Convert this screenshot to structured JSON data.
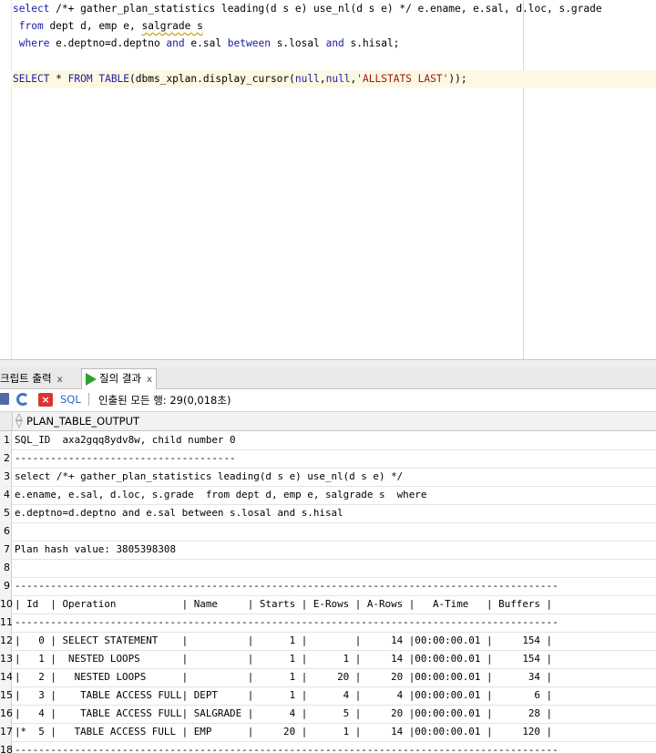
{
  "editor": {
    "lines": [
      {
        "tokens": [
          {
            "t": "select",
            "c": "kw"
          },
          {
            "t": " /*+ gather_plan_statistics leading(d s e) use_nl(d s e) */ e.ename, e.sal, d.loc, s.grade",
            "c": "cm"
          }
        ]
      },
      {
        "tokens": [
          {
            "t": " ",
            "c": ""
          },
          {
            "t": "from",
            "c": "kw"
          },
          {
            "t": " dept d, emp e, ",
            "c": ""
          },
          {
            "t": "salgrade s",
            "c": "sq"
          }
        ]
      },
      {
        "tokens": [
          {
            "t": " ",
            "c": ""
          },
          {
            "t": "where",
            "c": "kw"
          },
          {
            "t": " e.deptno=d.deptno ",
            "c": ""
          },
          {
            "t": "and",
            "c": "kw"
          },
          {
            "t": " e.sal ",
            "c": ""
          },
          {
            "t": "between",
            "c": "kw"
          },
          {
            "t": " s.losal ",
            "c": ""
          },
          {
            "t": "and",
            "c": "kw"
          },
          {
            "t": " s.hisal;",
            "c": ""
          }
        ]
      },
      {
        "tokens": []
      },
      {
        "tokens": [
          {
            "t": "SELECT",
            "c": "kw"
          },
          {
            "t": " * ",
            "c": ""
          },
          {
            "t": "FROM",
            "c": "kw"
          },
          {
            "t": " ",
            "c": ""
          },
          {
            "t": "TABLE",
            "c": "kw"
          },
          {
            "t": "(dbms_xplan.display_cursor(",
            "c": ""
          },
          {
            "t": "null",
            "c": "kw"
          },
          {
            "t": ",",
            "c": ""
          },
          {
            "t": "null",
            "c": "kw"
          },
          {
            "t": ",",
            "c": ""
          },
          {
            "t": "'ALLSTATS LAST'",
            "c": "str"
          },
          {
            "t": "));",
            "c": ""
          }
        ]
      }
    ],
    "current_line": 4
  },
  "tabs": [
    {
      "label": "크립트 출력",
      "close": "x",
      "active": false
    },
    {
      "label": "질의 결과",
      "close": "x",
      "active": true
    }
  ],
  "toolbar": {
    "sql_label": "SQL",
    "fetch_text": "인출된 모든 행: 29(0,018초)"
  },
  "grid": {
    "column": "PLAN_TABLE_OUTPUT",
    "rows": [
      {
        "n": "1",
        "text": "SQL_ID  axa2gqq8ydv8w, child number 0"
      },
      {
        "n": "2",
        "text": "-------------------------------------"
      },
      {
        "n": "3",
        "text": "select /*+ gather_plan_statistics leading(d s e) use_nl(d s e) */"
      },
      {
        "n": "4",
        "text": "e.ename, e.sal, d.loc, s.grade  from dept d, emp e, salgrade s  where"
      },
      {
        "n": "5",
        "text": "e.deptno=d.deptno and e.sal between s.losal and s.hisal"
      },
      {
        "n": "6",
        "text": ""
      },
      {
        "n": "7",
        "text": "Plan hash value: 3805398308"
      },
      {
        "n": "8",
        "text": ""
      },
      {
        "n": "9",
        "text": "-------------------------------------------------------------------------------------------"
      },
      {
        "n": "10",
        "text": "| Id  | Operation           | Name     | Starts | E-Rows | A-Rows |   A-Time   | Buffers |"
      },
      {
        "n": "11",
        "text": "-------------------------------------------------------------------------------------------"
      },
      {
        "n": "12",
        "text": "|   0 | SELECT STATEMENT    |          |      1 |        |     14 |00:00:00.01 |     154 |"
      },
      {
        "n": "13",
        "text": "|   1 |  NESTED LOOPS       |          |      1 |      1 |     14 |00:00:00.01 |     154 |"
      },
      {
        "n": "14",
        "text": "|   2 |   NESTED LOOPS      |          |      1 |     20 |     20 |00:00:00.01 |      34 |"
      },
      {
        "n": "15",
        "text": "|   3 |    TABLE ACCESS FULL| DEPT     |      1 |      4 |      4 |00:00:00.01 |       6 |"
      },
      {
        "n": "16",
        "text": "|   4 |    TABLE ACCESS FULL| SALGRADE |      4 |      5 |     20 |00:00:00.01 |      28 |"
      },
      {
        "n": "17",
        "text": "|*  5 |   TABLE ACCESS FULL | EMP      |     20 |      1 |     14 |00:00:00.01 |     120 |"
      },
      {
        "n": "18",
        "text": "-------------------------------------------------------------------------------------------"
      }
    ]
  }
}
